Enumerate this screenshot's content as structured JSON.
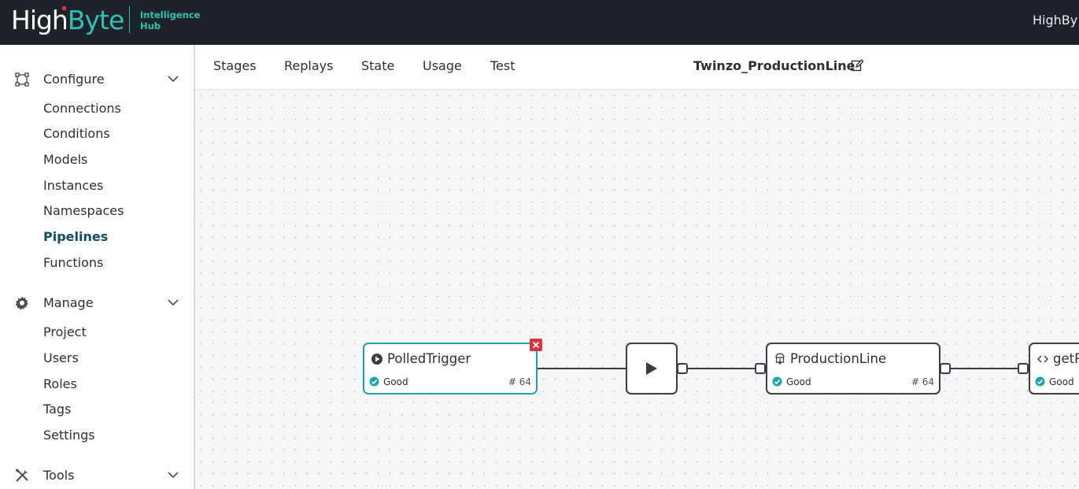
{
  "app": {
    "logo_high": "High",
    "logo_byte": "Byte",
    "subtitle_line1": "Intelligence",
    "subtitle_line2": "Hub",
    "user_label": "HighBy",
    "brand_color": "#2bc2b6",
    "topbar_color": "#1f2329"
  },
  "sidebar": {
    "sections": [
      {
        "label": "Configure",
        "icon": "configure-icon",
        "items": [
          "Connections",
          "Conditions",
          "Models",
          "Instances",
          "Namespaces",
          "Pipelines",
          "Functions"
        ]
      },
      {
        "label": "Manage",
        "icon": "gear-icon",
        "items": [
          "Project",
          "Users",
          "Roles",
          "Tags",
          "Settings"
        ]
      },
      {
        "label": "Tools",
        "icon": "tools-icon",
        "items": []
      }
    ],
    "active_item": "Pipelines"
  },
  "header": {
    "tabs": [
      "Stages",
      "Replays",
      "State",
      "Usage",
      "Test"
    ],
    "pipeline_name": "Twinzo_ProductionLine"
  },
  "canvas": {
    "nodes": [
      {
        "title": "PolledTrigger",
        "icon": "trigger-icon",
        "status": "Good",
        "count": "# 64",
        "selected": true
      },
      {
        "title": "",
        "icon": "play-icon",
        "status": "",
        "count": ""
      },
      {
        "title": "ProductionLine",
        "icon": "read-icon",
        "status": "Good",
        "count": "# 64"
      },
      {
        "title": "getP",
        "icon": "code-icon",
        "status": "Good",
        "count": ""
      }
    ],
    "status_color": "#1aa6a8",
    "remove_color": "#d9343d"
  }
}
